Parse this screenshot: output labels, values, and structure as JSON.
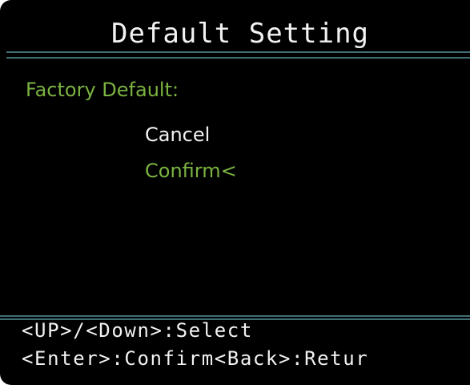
{
  "screen": {
    "title": "Default Setting",
    "section_label": "Factory Default:",
    "options": [
      {
        "label": "Cancel",
        "selected": false
      },
      {
        "label": "Confirm<",
        "selected": true
      }
    ],
    "footer": {
      "line1": "<UP>/<Down>:Select",
      "line2": "<Enter>:Confirm<Back>:Retur"
    }
  },
  "colors": {
    "background": "#000000",
    "text": "#f2f2f2",
    "highlight": "#7bb341",
    "separator": "#3f6e74"
  }
}
